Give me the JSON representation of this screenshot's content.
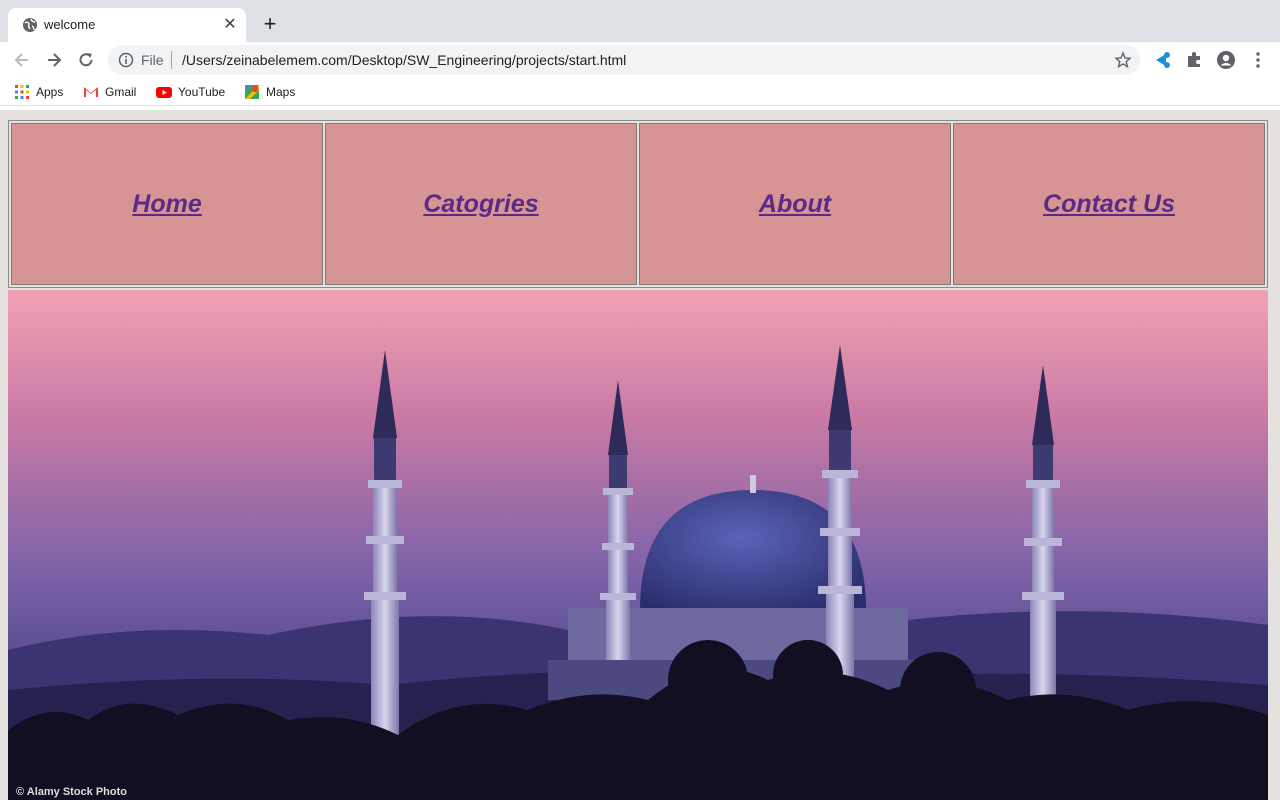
{
  "browser": {
    "tab": {
      "title": "welcome"
    },
    "address_bar": {
      "scheme": "File",
      "url": "/Users/zeinabelemem.com/Desktop/SW_Engineering/projects/start.html"
    },
    "bookmarks": [
      {
        "label": "Apps",
        "icon": "apps-grid-icon"
      },
      {
        "label": "Gmail",
        "icon": "gmail-icon"
      },
      {
        "label": "YouTube",
        "icon": "youtube-icon"
      },
      {
        "label": "Maps",
        "icon": "maps-icon"
      }
    ]
  },
  "page": {
    "nav": [
      {
        "label": "Home"
      },
      {
        "label": "Catogries"
      },
      {
        "label": "About"
      },
      {
        "label": "Contact Us"
      }
    ],
    "hero": {
      "watermark": "© Alamy Stock Photo"
    }
  },
  "colors": {
    "nav_cell_bg": "#d69594",
    "nav_link": "#5b2a86",
    "page_bg": "#e4e1df"
  }
}
